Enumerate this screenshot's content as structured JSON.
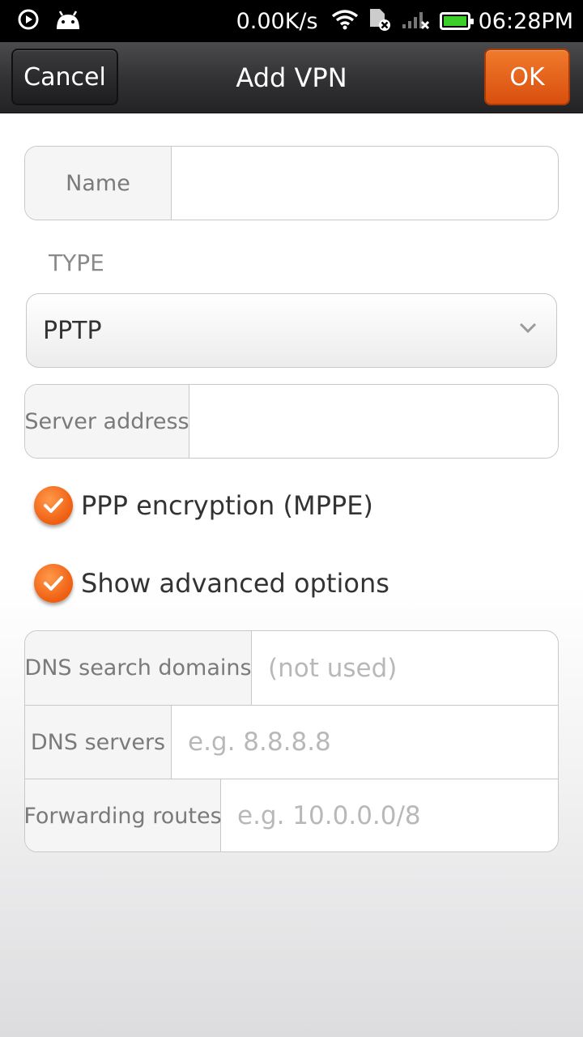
{
  "status_bar": {
    "net_speed": "0.00K/s",
    "time": "06:28PM",
    "icons": [
      "play-circle-icon",
      "android-icon",
      "wifi-icon",
      "sim-off-icon",
      "signal-icon",
      "battery-icon"
    ],
    "battery_color": "#3ccf2a"
  },
  "header": {
    "title": "Add VPN",
    "cancel_label": "Cancel",
    "ok_label": "OK",
    "ok_color": "#e8651d"
  },
  "form": {
    "name": {
      "label": "Name",
      "value": ""
    },
    "type_section_label": "TYPE",
    "type_value": "PPTP",
    "server": {
      "label": "Server address",
      "value": ""
    },
    "ppp_encryption": {
      "label": "PPP encryption (MPPE)",
      "checked": true
    },
    "show_advanced": {
      "label": "Show advanced options",
      "checked": true
    },
    "advanced": [
      {
        "label": "DNS search domains",
        "placeholder": "(not used)"
      },
      {
        "label": "DNS servers",
        "placeholder": "e.g. 8.8.8.8"
      },
      {
        "label": "Forwarding routes",
        "placeholder": "e.g. 10.0.0.0/8"
      }
    ]
  }
}
